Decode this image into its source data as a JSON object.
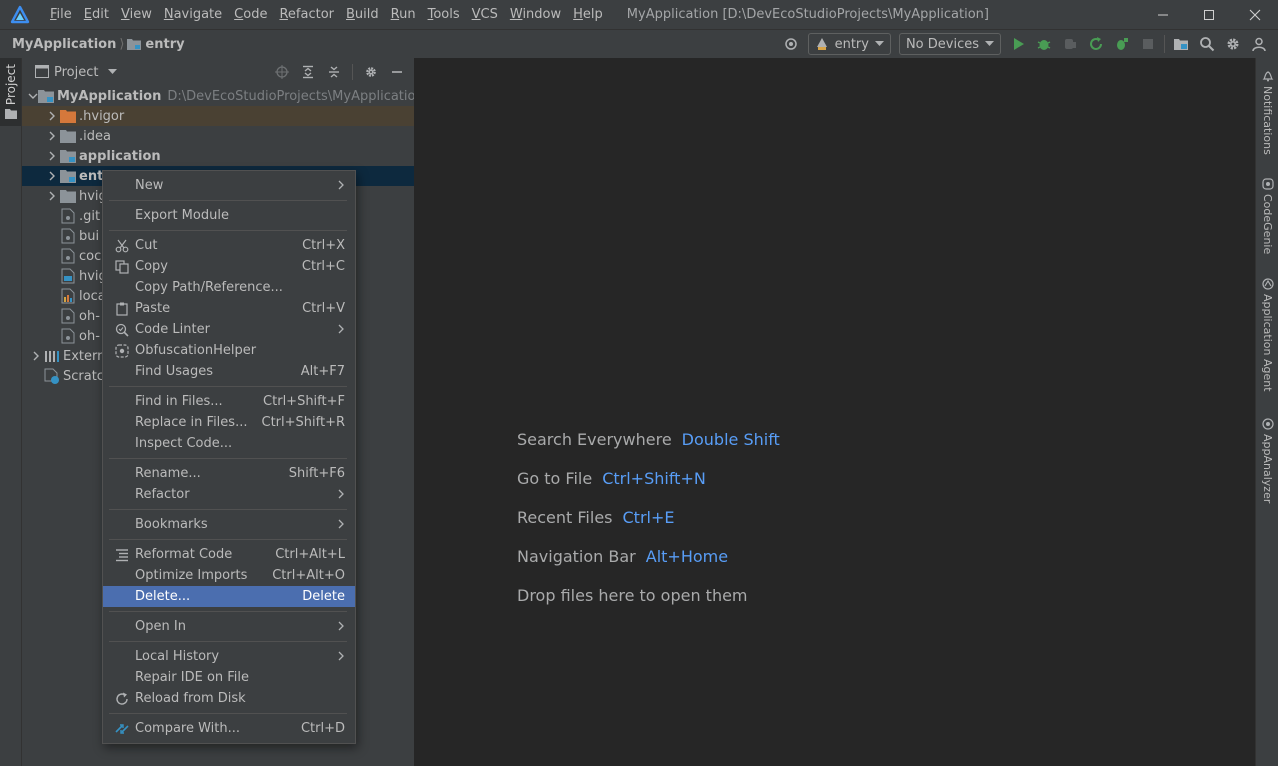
{
  "menubar": {
    "items": [
      "File",
      "Edit",
      "View",
      "Navigate",
      "Code",
      "Refactor",
      "Build",
      "Run",
      "Tools",
      "VCS",
      "Window",
      "Help"
    ],
    "window_title": "MyApplication [D:\\DevEcoStudioProjects\\MyApplication]"
  },
  "breadcrumb": {
    "project": "MyApplication",
    "module": "entry"
  },
  "toolbar": {
    "run_config": "entry",
    "device": "No Devices"
  },
  "project_panel": {
    "title": "Project"
  },
  "left_stripe": {
    "project_tab": "Project"
  },
  "tree": {
    "root_label": "MyApplication",
    "root_path": "D:\\DevEcoStudioProjects\\MyApplication",
    "items": [
      {
        "label": ".hvigor"
      },
      {
        "label": ".idea"
      },
      {
        "label": "application"
      },
      {
        "label": "ent"
      },
      {
        "label": "hvig"
      },
      {
        "label": ".git"
      },
      {
        "label": "bui"
      },
      {
        "label": "coc"
      },
      {
        "label": "hvig"
      },
      {
        "label": "loca"
      },
      {
        "label": "oh-"
      },
      {
        "label": "oh-"
      },
      {
        "label": "Extern"
      },
      {
        "label": "Scratc"
      }
    ]
  },
  "context_menu": {
    "items": [
      {
        "label": "New",
        "submenu": true
      },
      {
        "label": "Export Module"
      },
      {
        "label": "Cut",
        "shortcut": "Ctrl+X",
        "icon": "scissors-icon"
      },
      {
        "label": "Copy",
        "shortcut": "Ctrl+C",
        "icon": "copy-icon"
      },
      {
        "label": "Copy Path/Reference..."
      },
      {
        "label": "Paste",
        "shortcut": "Ctrl+V",
        "icon": "paste-icon"
      },
      {
        "label": "Code Linter",
        "submenu": true,
        "icon": "code-linter-icon"
      },
      {
        "label": "ObfuscationHelper",
        "icon": "obfuscation-icon"
      },
      {
        "label": "Find Usages",
        "shortcut": "Alt+F7"
      },
      {
        "label": "Find in Files...",
        "shortcut": "Ctrl+Shift+F"
      },
      {
        "label": "Replace in Files...",
        "shortcut": "Ctrl+Shift+R"
      },
      {
        "label": "Inspect Code..."
      },
      {
        "label": "Rename...",
        "shortcut": "Shift+F6"
      },
      {
        "label": "Refactor",
        "submenu": true
      },
      {
        "label": "Bookmarks",
        "submenu": true
      },
      {
        "label": "Reformat Code",
        "shortcut": "Ctrl+Alt+L",
        "icon": "reformat-icon"
      },
      {
        "label": "Optimize Imports",
        "shortcut": "Ctrl+Alt+O"
      },
      {
        "label": "Delete...",
        "shortcut": "Delete",
        "highlighted": true
      },
      {
        "label": "Open In",
        "submenu": true
      },
      {
        "label": "Local History",
        "submenu": true
      },
      {
        "label": "Repair IDE on File"
      },
      {
        "label": "Reload from Disk",
        "icon": "reload-icon"
      },
      {
        "label": "Compare With...",
        "shortcut": "Ctrl+D",
        "icon": "compare-icon"
      }
    ]
  },
  "editor_hints": [
    {
      "text": "Search Everywhere",
      "key": "Double Shift"
    },
    {
      "text": "Go to File",
      "key": "Ctrl+Shift+N"
    },
    {
      "text": "Recent Files",
      "key": "Ctrl+E"
    },
    {
      "text": "Navigation Bar",
      "key": "Alt+Home"
    },
    {
      "text": "Drop files here to open them",
      "key": ""
    }
  ],
  "right_stripe": {
    "tabs": [
      "Notifications",
      "CodeGenie",
      "Application Agent",
      "AppAnalyzer"
    ]
  },
  "colors": {
    "accent": "#4b6eaf",
    "link": "#589df6",
    "run_green": "#499c54",
    "selection": "#0d293e"
  }
}
